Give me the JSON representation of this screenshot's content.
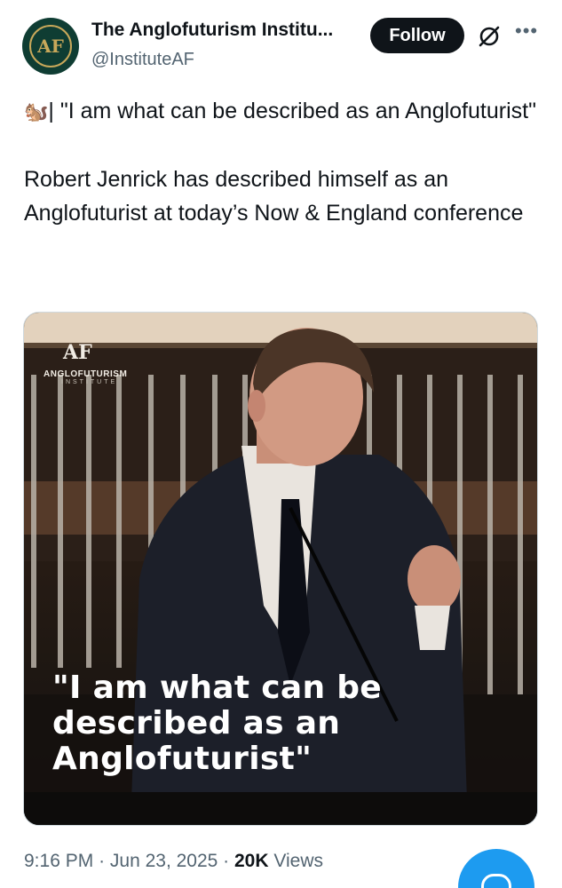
{
  "author": {
    "name": "The Anglofuturism Institu...",
    "handle": "@InstituteAF",
    "avatar_monogram": "AF"
  },
  "actions": {
    "follow_label": "Follow",
    "grok_icon": "grok-icon",
    "more_icon": "more-dots-icon"
  },
  "tweet": {
    "emoji": "🐿️",
    "line1": "| \"I am what can be described as an Anglofuturist\"",
    "line2": "Robert Jenrick has described himself as an Anglofuturist at today’s Now & England conference"
  },
  "media": {
    "logo_monogram": "AF",
    "logo_name": "ANGLOFUTURISM",
    "logo_sub": "INSTITUTE",
    "caption": "\"I am what can be described as an Anglofuturist\""
  },
  "meta": {
    "time": "9:16 PM",
    "date": "Jun 23, 2025",
    "views_count": "20K",
    "views_label": "Views"
  },
  "colors": {
    "accent": "#1d9bf0",
    "text": "#0f1419",
    "secondary": "#536471",
    "avatar_bg": "#0f3d33",
    "avatar_gold": "#c8a85a"
  }
}
